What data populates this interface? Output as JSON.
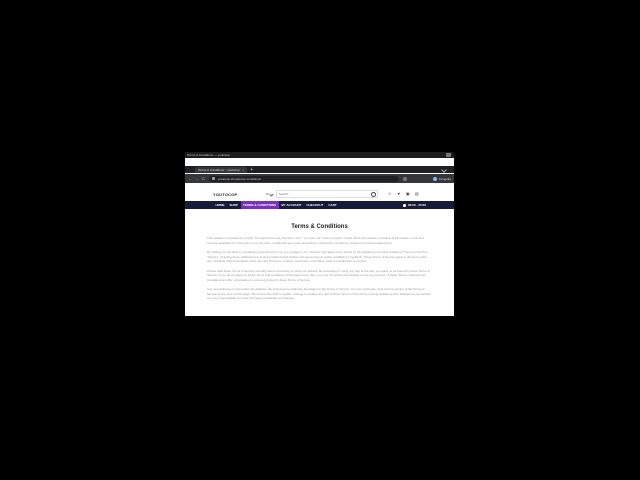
{
  "browser": {
    "os_strip_text": "Terms & Conditions — youtocop",
    "tab_title": "Terms & Conditions – youtocop",
    "tab_close": "×",
    "new_tab": "+",
    "back": "←",
    "forward": "→",
    "reload": "C",
    "url": "youtocop.shop/terms-conditions/",
    "incognito_label": "Incognito"
  },
  "site": {
    "logo": "YOUTOCOP",
    "category_select": "All",
    "search_placeholder": "Search",
    "header_icons": [
      "user-icon",
      "heart-icon",
      "cart-icon",
      "compare-icon"
    ],
    "menu": [
      "HOME",
      "SHOP",
      "TERMS & CONDITIONS",
      "MY ACCOUNT",
      "CHECKOUT",
      "CART"
    ],
    "active_menu": "TERMS & CONDITIONS",
    "phone": "09:00 - 20:00",
    "colors": {
      "nav_bg": "#141c3a",
      "active_menu": "#7b2fbe"
    }
  },
  "content": {
    "title": "Terms & Conditions",
    "paragraphs": [
      "This website is operated by Cop24. Throughout the site, the terms \"we\", \"us\" and \"our\" refer to Cop24. Cop24 offers this website, including all information, tools and services available from this site to you, the user, conditioned upon your acceptance of all terms, conditions, policies and notices stated here.",
      "By visiting our site and/ or purchasing something from us, you engage in our \"Service\" and agree to be bound by the following terms and conditions (\"Terms of Service\", \"Terms\"), including those additional terms and conditions and policies referenced herein and/or available by hyperlink. These Terms of Service apply to all users of the site, including without limitation users who are browsers, vendors, customers, merchants, and/ or contributors of content.",
      "Please read these Terms of Service carefully before accessing or using our website. By accessing or using any part of the site, you agree to be bound by these Terms of Service. If you do not agree to all the terms and conditions of this agreement, then you may not access the website or use any services. If these Terms of Service are considered an offer, acceptance is expressly limited to these Terms of Service.",
      "Any new features or tools which are added to the current store shall also be subject to the Terms of Service. You can review the most current version of the Terms of Service at any time on this page. We reserve the right to update, change or replace any part of these Terms of Service by posting updates and/or changes to our website. It is your responsibility to check this page periodically for changes."
    ]
  }
}
